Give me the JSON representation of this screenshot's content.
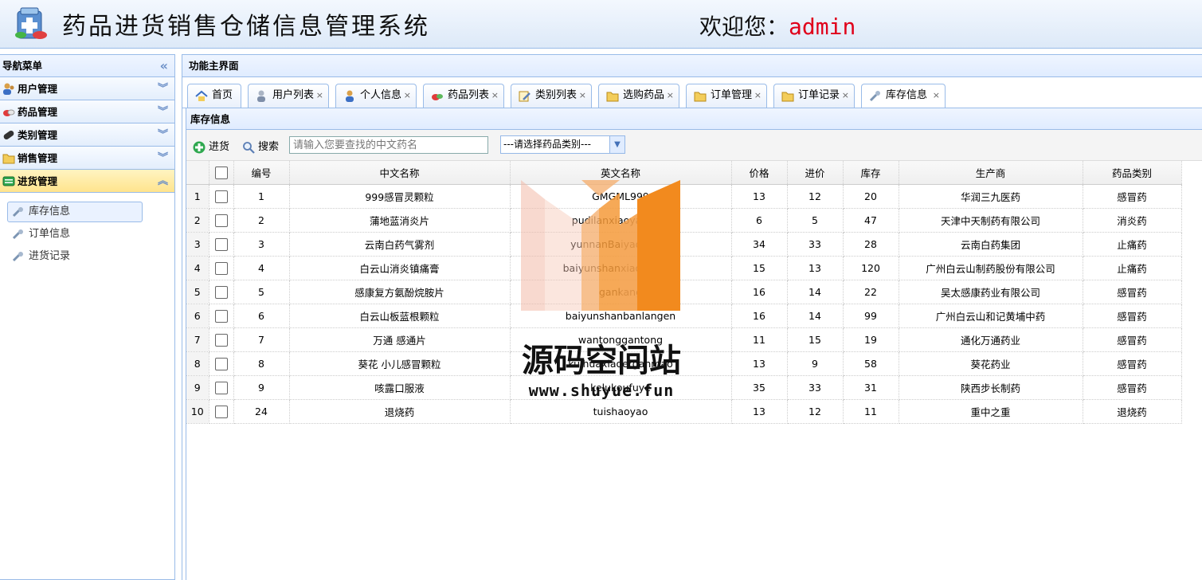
{
  "header": {
    "title": "药品进货销售仓储信息管理系统",
    "welcome_prefix": "欢迎您：",
    "username": "admin"
  },
  "nav": {
    "title": "导航菜单",
    "groups": [
      {
        "label": "用户管理",
        "icon": "users-icon"
      },
      {
        "label": "药品管理",
        "icon": "pills-icon"
      },
      {
        "label": "类别管理",
        "icon": "capsule-icon"
      },
      {
        "label": "销售管理",
        "icon": "folder-icon"
      },
      {
        "label": "进货管理",
        "icon": "table-icon",
        "active": true
      }
    ],
    "sub_items": [
      "库存信息",
      "订单信息",
      "进货记录"
    ]
  },
  "main": {
    "title": "功能主界面",
    "tabs": [
      {
        "label": "首页",
        "icon": "home-icon"
      },
      {
        "label": "用户列表",
        "icon": "users-icon"
      },
      {
        "label": "个人信息",
        "icon": "user-icon"
      },
      {
        "label": "药品列表",
        "icon": "pills-icon"
      },
      {
        "label": "类别列表",
        "icon": "pencil-icon"
      },
      {
        "label": "选购药品",
        "icon": "folder-icon"
      },
      {
        "label": "订单管理",
        "icon": "folder-icon"
      },
      {
        "label": "订单记录",
        "icon": "folder-icon"
      },
      {
        "label": "库存信息",
        "icon": "wrench-icon",
        "active": true
      }
    ],
    "close_glyph": "×"
  },
  "grid": {
    "title": "库存信息",
    "toolbar": {
      "stock_in": "进货",
      "search": "搜索",
      "search_placeholder": "请输入您要查找的中文药名",
      "category_select": "---请选择药品类别---"
    },
    "columns": [
      "编号",
      "中文名称",
      "英文名称",
      "价格",
      "进价",
      "库存",
      "生产商",
      "药品类别"
    ],
    "rows": [
      {
        "n": "1",
        "id": "1",
        "cn": "999感冒灵颗粒",
        "en": "GMGML999",
        "price": "13",
        "cost": "12",
        "stock": "20",
        "maker": "华润三九医药",
        "cat": "感冒药"
      },
      {
        "n": "2",
        "id": "2",
        "cn": "蒲地蓝消炎片",
        "en": "pudilanxiaoyanpian",
        "price": "6",
        "cost": "5",
        "stock": "47",
        "maker": "天津中天制药有限公司",
        "cat": "消炎药"
      },
      {
        "n": "3",
        "id": "3",
        "cn": "云南白药气雾剂",
        "en": "yunnanBaiyaoqiwuji",
        "price": "34",
        "cost": "33",
        "stock": "28",
        "maker": "云南白药集团",
        "cat": "止痛药"
      },
      {
        "n": "4",
        "id": "4",
        "cn": "白云山消炎镇痛膏",
        "en": "baiyunshanxiaoyangao",
        "price": "15",
        "cost": "13",
        "stock": "120",
        "maker": "广州白云山制药股份有限公司",
        "cat": "止痛药"
      },
      {
        "n": "5",
        "id": "5",
        "cn": "感康复方氨酚烷胺片",
        "en": "gankang",
        "price": "16",
        "cost": "14",
        "stock": "22",
        "maker": "吴太感康药业有限公司",
        "cat": "感冒药"
      },
      {
        "n": "6",
        "id": "6",
        "cn": "白云山板蓝根颗粒",
        "en": "baiyunshanbanlangen",
        "price": "16",
        "cost": "14",
        "stock": "99",
        "maker": "广州白云山和记黄埔中药",
        "cat": "感冒药"
      },
      {
        "n": "7",
        "id": "7",
        "cn": "万通 感通片",
        "en": "wantonggantong",
        "price": "11",
        "cost": "15",
        "stock": "19",
        "maker": "通化万通药业",
        "cat": "感冒药"
      },
      {
        "n": "8",
        "id": "8",
        "cn": "葵花 小儿感冒颗粒",
        "en": "kuihuaxiaoerganmao",
        "price": "13",
        "cost": "9",
        "stock": "58",
        "maker": "葵花药业",
        "cat": "感冒药"
      },
      {
        "n": "9",
        "id": "9",
        "cn": "咳露口服液",
        "en": "kelukoufuye",
        "price": "35",
        "cost": "33",
        "stock": "31",
        "maker": "陕西步长制药",
        "cat": "感冒药"
      },
      {
        "n": "10",
        "id": "24",
        "cn": "退烧药",
        "en": "tuishaoyao",
        "price": "13",
        "cost": "12",
        "stock": "11",
        "maker": "重中之重",
        "cat": "退烧药"
      }
    ]
  },
  "watermark": {
    "text": "源码空间站",
    "url": "www.shuyue.fun"
  },
  "colors": {
    "accent": "#99bbe8",
    "username": "#e0001a",
    "active_menu": "#ffe48d",
    "watermark_orange": "#f28a1e"
  }
}
